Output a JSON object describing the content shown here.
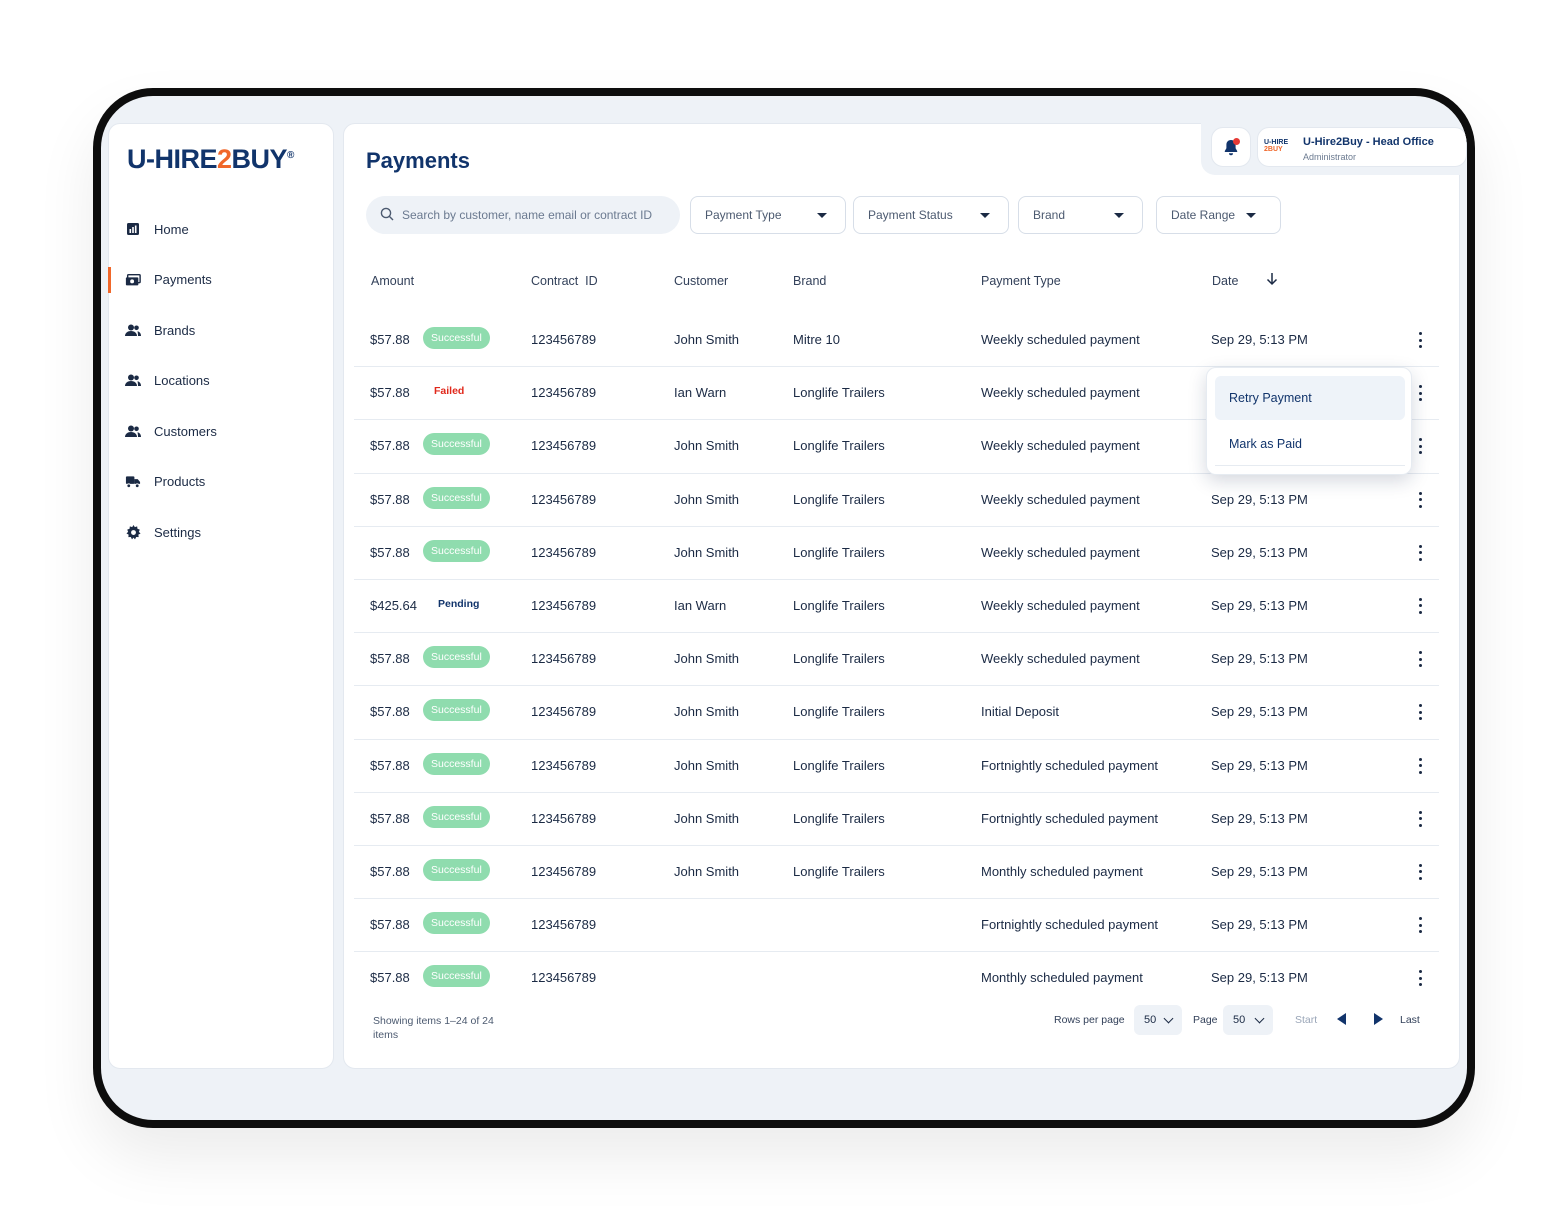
{
  "brand": {
    "logo_pre": "U-HIRE",
    "logo_two": "2",
    "logo_post": "BUY",
    "logo_reg": "®",
    "accent": "#f0672a",
    "primary": "#11346b"
  },
  "sidebar": {
    "items": [
      {
        "label": "Home",
        "icon": "bar-chart-icon"
      },
      {
        "label": "Payments",
        "icon": "money-icon"
      },
      {
        "label": "Brands",
        "icon": "users-icon"
      },
      {
        "label": "Locations",
        "icon": "users-icon"
      },
      {
        "label": "Customers",
        "icon": "users-icon"
      },
      {
        "label": "Products",
        "icon": "truck-icon"
      },
      {
        "label": "Settings",
        "icon": "gear-icon"
      }
    ]
  },
  "header": {
    "title": "Payments"
  },
  "account": {
    "logo_top": "U-HIRE",
    "logo_bottom": "2BUY",
    "name": "U-Hire2Buy - Head Office",
    "role": "Administrator"
  },
  "filters": {
    "search_placeholder": "Search by customer, name email or contract ID",
    "payment_type": "Payment Type",
    "payment_status": "Payment Status",
    "brand": "Brand",
    "date_range": "Date Range"
  },
  "table": {
    "columns": [
      "Amount",
      "Contract  ID",
      "Customer",
      "Brand",
      "Payment Type",
      "Date"
    ],
    "rows": [
      {
        "amount": "$57.88",
        "status": "Successful",
        "contract": "123456789",
        "customer": "John Smith",
        "brand": "Mitre 10",
        "type": "Weekly scheduled payment",
        "date": "Sep 29, 5:13 PM"
      },
      {
        "amount": "$57.88",
        "status": "Failed",
        "contract": "123456789",
        "customer": "Ian Warn",
        "brand": "Longlife Trailers",
        "type": "Weekly scheduled payment",
        "date": ""
      },
      {
        "amount": "$57.88",
        "status": "Successful",
        "contract": "123456789",
        "customer": "John Smith",
        "brand": "Longlife Trailers",
        "type": "Weekly scheduled payment",
        "date": ""
      },
      {
        "amount": "$57.88",
        "status": "Successful",
        "contract": "123456789",
        "customer": "John Smith",
        "brand": "Longlife Trailers",
        "type": "Weekly scheduled payment",
        "date": "Sep 29, 5:13 PM"
      },
      {
        "amount": "$57.88",
        "status": "Successful",
        "contract": "123456789",
        "customer": "John Smith",
        "brand": "Longlife Trailers",
        "type": "Weekly scheduled payment",
        "date": "Sep 29, 5:13 PM"
      },
      {
        "amount": "$425.64",
        "status": "Pending",
        "contract": "123456789",
        "customer": "Ian Warn",
        "brand": "Longlife Trailers",
        "type": "Weekly scheduled payment",
        "date": "Sep 29, 5:13 PM"
      },
      {
        "amount": "$57.88",
        "status": "Successful",
        "contract": "123456789",
        "customer": "John Smith",
        "brand": "Longlife Trailers",
        "type": "Weekly scheduled payment",
        "date": "Sep 29, 5:13 PM"
      },
      {
        "amount": "$57.88",
        "status": "Successful",
        "contract": "123456789",
        "customer": "John Smith",
        "brand": "Longlife Trailers",
        "type": "Initial Deposit",
        "date": "Sep 29, 5:13 PM"
      },
      {
        "amount": "$57.88",
        "status": "Successful",
        "contract": "123456789",
        "customer": "John Smith",
        "brand": "Longlife Trailers",
        "type": "Fortnightly scheduled payment",
        "date": "Sep 29, 5:13 PM"
      },
      {
        "amount": "$57.88",
        "status": "Successful",
        "contract": "123456789",
        "customer": "John Smith",
        "brand": "Longlife Trailers",
        "type": "Fortnightly scheduled payment",
        "date": "Sep 29, 5:13 PM"
      },
      {
        "amount": "$57.88",
        "status": "Successful",
        "contract": "123456789",
        "customer": "John Smith",
        "brand": "Longlife Trailers",
        "type": "Monthly scheduled payment",
        "date": "Sep 29, 5:13 PM"
      },
      {
        "amount": "$57.88",
        "status": "Successful",
        "contract": "123456789",
        "customer": "",
        "brand": "",
        "type": "Fortnightly scheduled payment",
        "date": "Sep 29, 5:13 PM"
      },
      {
        "amount": "$57.88",
        "status": "Successful",
        "contract": "123456789",
        "customer": "",
        "brand": "",
        "type": "Monthly scheduled payment",
        "date": "Sep 29, 5:13 PM"
      }
    ]
  },
  "row_menu": {
    "retry": "Retry Payment",
    "mark_paid": "Mark as Paid"
  },
  "footer": {
    "showing": "Showing items 1–24 of 24 items",
    "rows_per_page_label": "Rows per page",
    "rows_per_page": "50",
    "page_label": "Page",
    "page": "50",
    "start": "Start",
    "last": "Last"
  }
}
